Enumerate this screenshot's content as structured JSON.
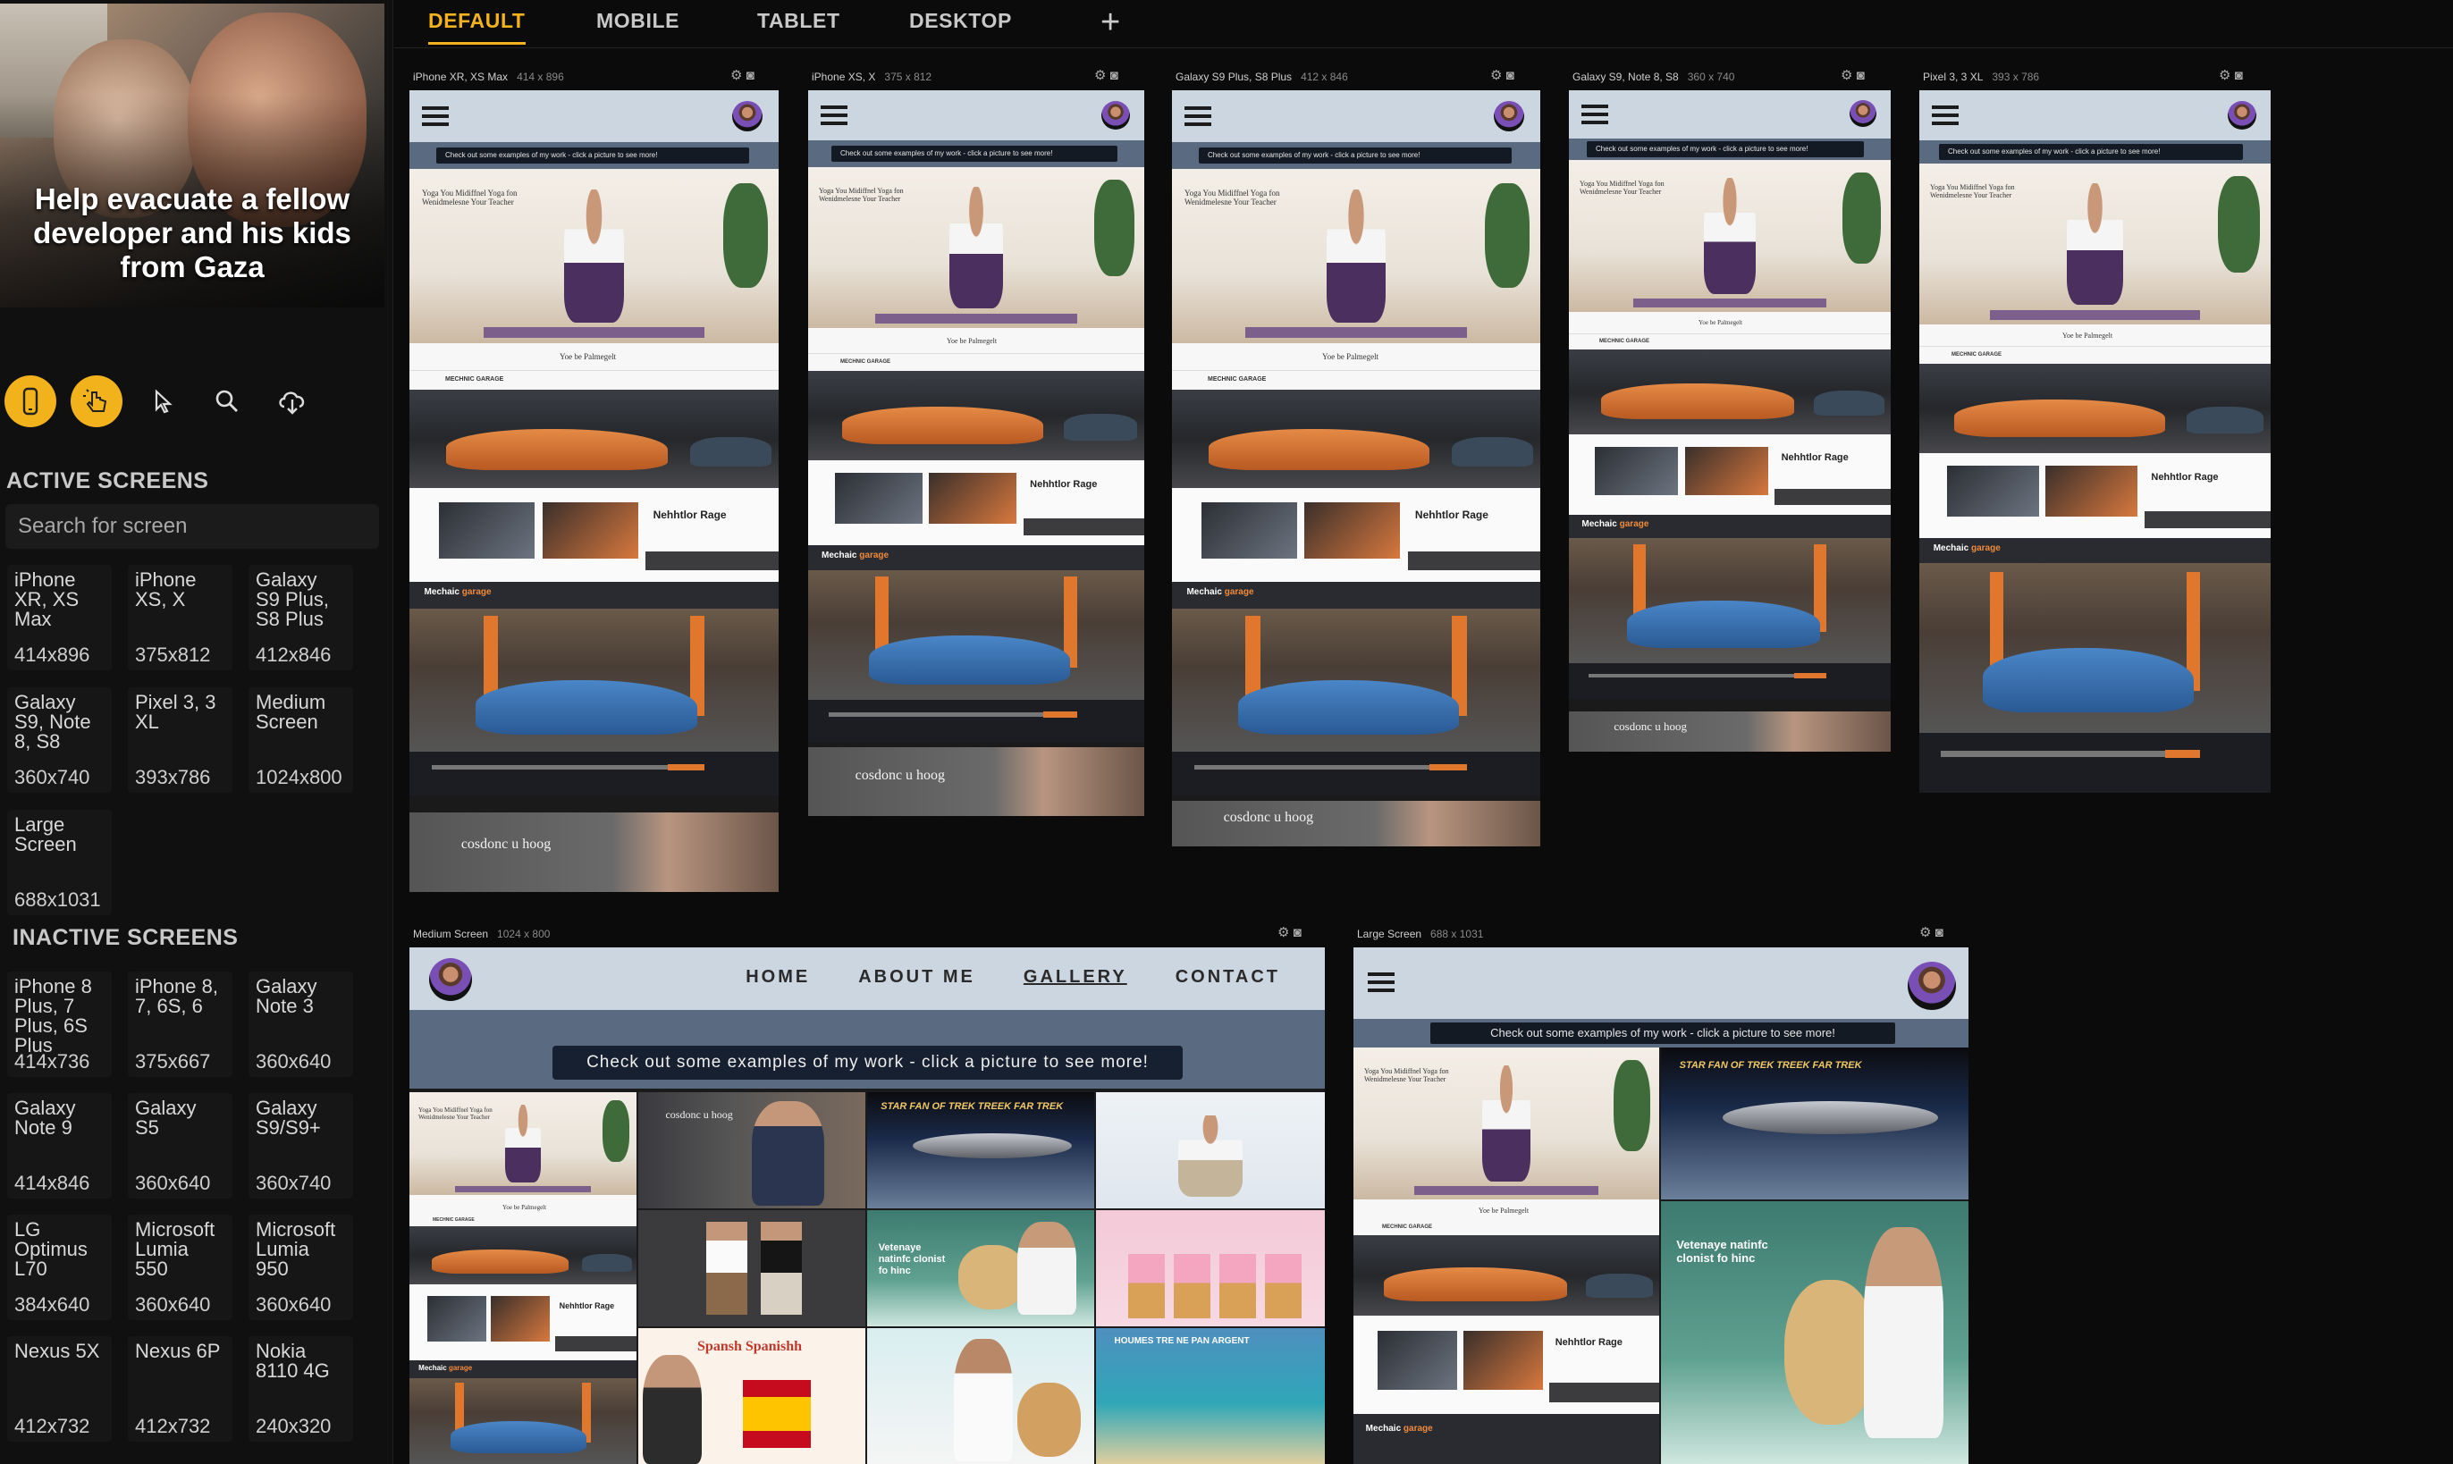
{
  "sidebar": {
    "banner_text": "Help evacuate a fellow developer and his kids from Gaza",
    "tools": [
      {
        "icon": "device-phone-icon",
        "active": true
      },
      {
        "icon": "hand-pointer-icon",
        "active": true
      },
      {
        "icon": "cursor-arrow-icon",
        "active": false
      },
      {
        "icon": "search-icon",
        "active": false
      },
      {
        "icon": "cloud-download-icon",
        "active": false
      }
    ],
    "active_heading": "ACTIVE SCREENS",
    "search_placeholder": "Search for screen",
    "active_screens": [
      {
        "name": "iPhone XR, XS Max",
        "res": "414x896"
      },
      {
        "name": "iPhone XS, X",
        "res": "375x812"
      },
      {
        "name": "Galaxy S9 Plus, S8 Plus",
        "res": "412x846"
      },
      {
        "name": "Galaxy S9, Note 8, S8",
        "res": "360x740"
      },
      {
        "name": "Pixel 3, 3 XL",
        "res": "393x786"
      },
      {
        "name": "Medium Screen",
        "res": "1024x800"
      },
      {
        "name": "Large Screen",
        "res": "688x1031"
      }
    ],
    "inactive_heading": "INACTIVE SCREENS",
    "inactive_screens": [
      {
        "name": "iPhone 8 Plus, 7 Plus, 6S Plus",
        "res": "414x736"
      },
      {
        "name": "iPhone 8, 7, 6S, 6",
        "res": "375x667"
      },
      {
        "name": "Galaxy Note 3",
        "res": "360x640"
      },
      {
        "name": "Galaxy Note 9",
        "res": "414x846"
      },
      {
        "name": "Galaxy S5",
        "res": "360x640"
      },
      {
        "name": "Galaxy S9/S9+",
        "res": "360x740"
      },
      {
        "name": "LG Optimus L70",
        "res": "384x640"
      },
      {
        "name": "Microsoft Lumia 550",
        "res": "360x640"
      },
      {
        "name": "Microsoft Lumia 950",
        "res": "360x640"
      },
      {
        "name": "Nexus 5X",
        "res": "412x732"
      },
      {
        "name": "Nexus 6P",
        "res": "412x732"
      },
      {
        "name": "Nokia 8110 4G",
        "res": "240x320"
      }
    ]
  },
  "tabs": [
    "DEFAULT",
    "MOBILE",
    "TABLET",
    "DESKTOP"
  ],
  "add_tab_label": "+",
  "frames": [
    {
      "label": "iPhone XR, XS Max",
      "res": "414 x 896"
    },
    {
      "label": "iPhone XS, X",
      "res": "375 x 812"
    },
    {
      "label": "Galaxy S9 Plus, S8 Plus",
      "res": "412 x 846"
    },
    {
      "label": "Galaxy S9, Note 8, S8",
      "res": "360 x 740"
    },
    {
      "label": "Pixel 3, 3 XL",
      "res": "393 x 786"
    },
    {
      "label": "Medium Screen",
      "res": "1024 x 800"
    },
    {
      "label": "Large Screen",
      "res": "688 x 1031"
    }
  ],
  "site": {
    "nav": [
      "HOME",
      "ABOUT ME",
      "GALLERY",
      "CONTACT"
    ],
    "cta": "Check out some examples of my work - click a picture to see more!",
    "yoga_heading": "Yoga You Midiffnel Yoga fon Wenidmelesne Your Teacher",
    "yoga_caption": "Yoe be Palmegelt",
    "garage_logo": "MECHNIC GARAGE",
    "card_title": "Nehhtlor Rage",
    "mechanic_logo": "Mechaic",
    "mechanic_logo_accent": "garage",
    "portfolio_text": "cosdonc u hoog",
    "startrek_title": "STAR FAN OF TREK TREEK FAR TREK",
    "vet_text": "Vetenaye natinfc clonist fo hinc",
    "spanish_title": "Spansh Spanishh",
    "beach_title": "HOUMES TRE NE PAN ARGENT"
  }
}
